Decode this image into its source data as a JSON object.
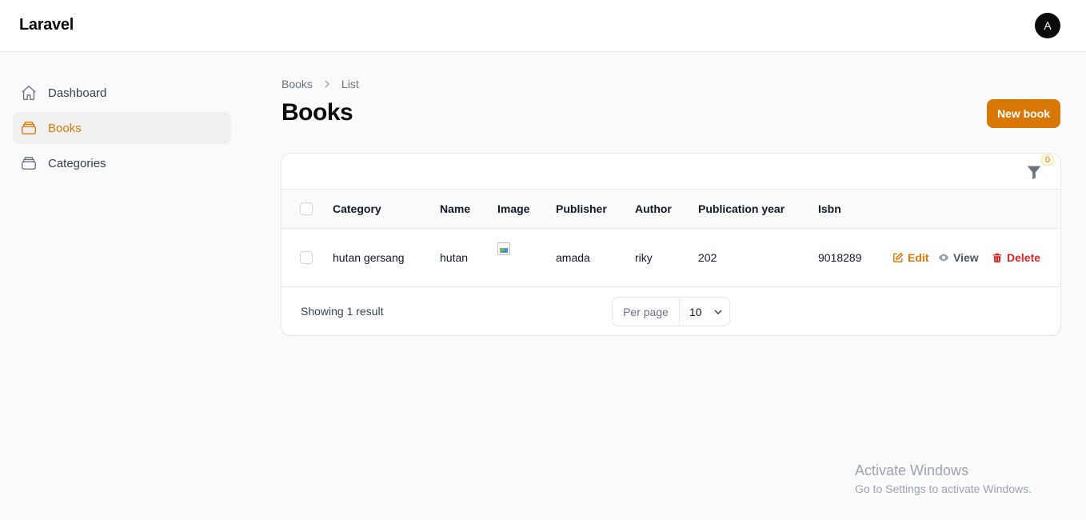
{
  "app": {
    "brand": "Laravel",
    "avatar_initial": "A"
  },
  "sidebar": {
    "items": [
      {
        "label": "Dashboard",
        "icon": "home-icon",
        "active": false
      },
      {
        "label": "Books",
        "icon": "stack-icon",
        "active": true
      },
      {
        "label": "Categories",
        "icon": "stack-icon",
        "active": false
      }
    ]
  },
  "breadcrumb": {
    "items": [
      "Books",
      "List"
    ]
  },
  "page": {
    "title": "Books",
    "new_button": "New book"
  },
  "table": {
    "filter_count": "0",
    "columns": [
      "Category",
      "Name",
      "Image",
      "Publisher",
      "Author",
      "Publication year",
      "Isbn"
    ],
    "rows": [
      {
        "category": "hutan gersang",
        "name": "hutan",
        "image": "broken-image-icon",
        "publisher": "amada",
        "author": "riky",
        "publication_year": "202",
        "isbn": "9018289",
        "actions": {
          "edit": "Edit",
          "view": "View",
          "delete": "Delete"
        }
      }
    ],
    "footer": {
      "summary": "Showing 1 result",
      "per_page_label": "Per page",
      "per_page_value": "10"
    }
  },
  "watermark": {
    "line1": "Activate Windows",
    "line2": "Go to Settings to activate Windows."
  },
  "colors": {
    "accent": "#d97706",
    "danger": "#dc2626",
    "text": "#111827"
  }
}
